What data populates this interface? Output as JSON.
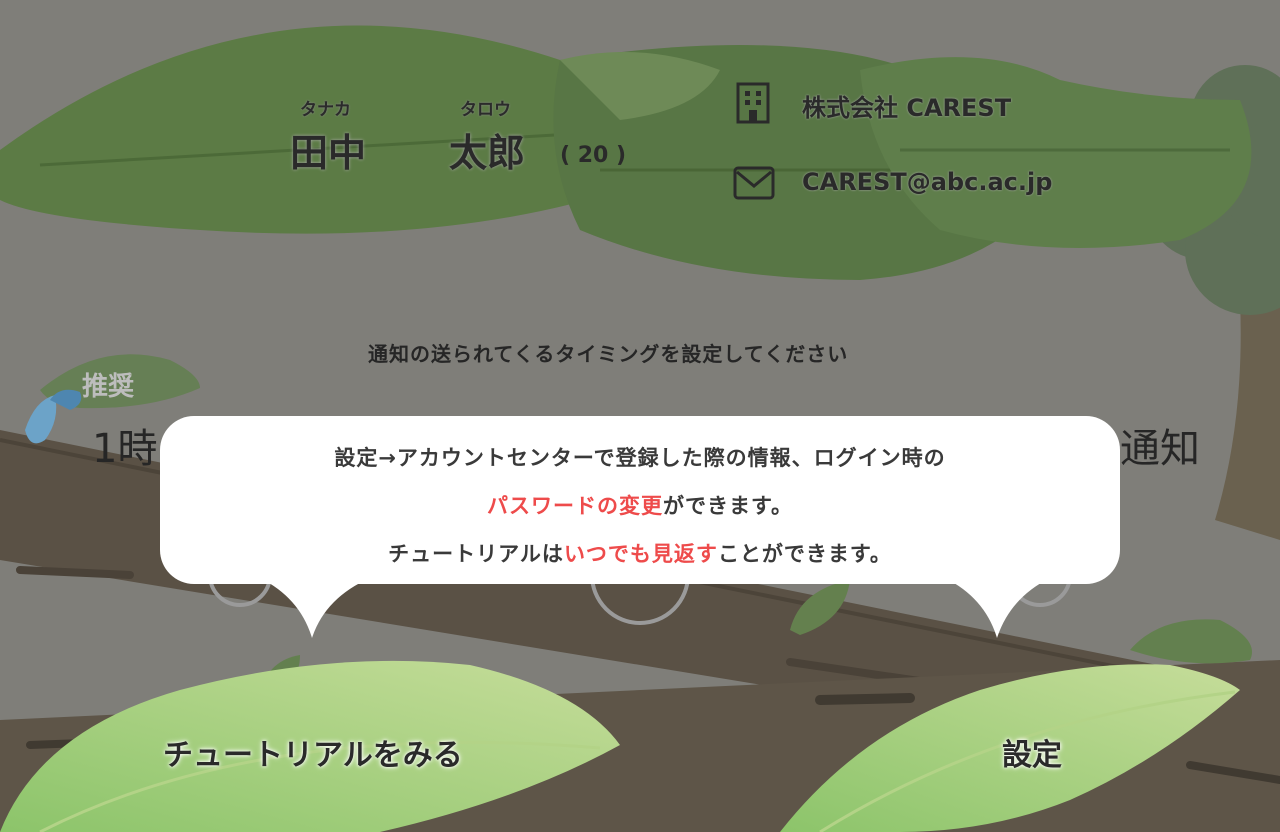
{
  "profile": {
    "last_name_kana": "タナカ",
    "last_name": "田中",
    "first_name_kana": "タロウ",
    "first_name": "太郎",
    "age": "( 20 )",
    "company_icon": "building-icon",
    "company": "株式会社 CAREST",
    "email_icon": "mail-icon",
    "email": "CAREST@abc.ac.jp"
  },
  "notification": {
    "prompt": "通知の送られてくるタイミングを設定してください",
    "recommended_badge": "推奨",
    "option_left_partial": "1時",
    "option_right_partial": "通知"
  },
  "tooltip": {
    "line1": "設定→アカウントセンターで登録した際の情報、ログイン時の",
    "line2_highlight": "パスワードの変更",
    "line2_rest": "ができます。",
    "line3_prefix": "チュートリアルは",
    "line3_highlight": "いつでも見返す",
    "line3_rest": "ことができます。"
  },
  "buttons": {
    "tutorial": "チュートリアルをみる",
    "settings": "設定"
  },
  "colors": {
    "overlay_bg": "#7f7e79",
    "highlight": "#ee4b4b",
    "leaf_dark": "#5a7a3c",
    "leaf_light": "#a9cf6f"
  }
}
